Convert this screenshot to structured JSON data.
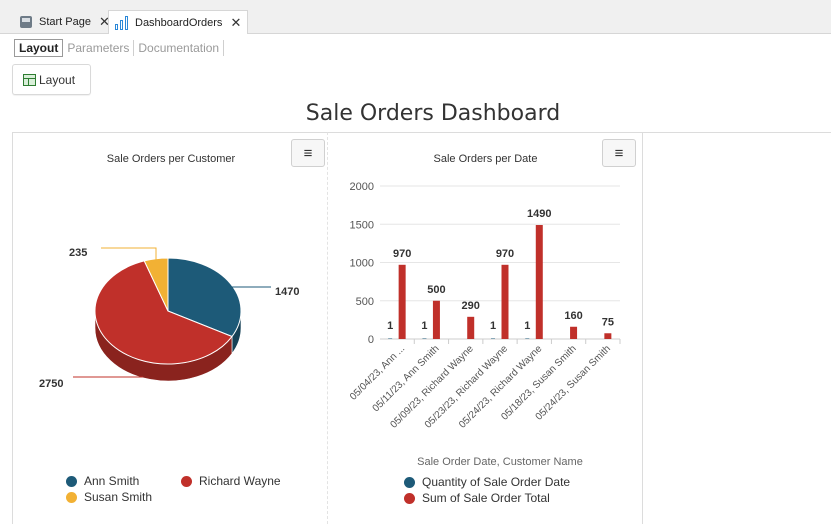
{
  "tabs": [
    {
      "label": "Start Page",
      "icon": "start-page-icon"
    },
    {
      "label": "DashboardOrders",
      "icon": "dashboard-icon"
    }
  ],
  "subtabs": [
    {
      "label": "Layout",
      "active": true
    },
    {
      "label": "Parameters",
      "active": false
    },
    {
      "label": "Documentation",
      "active": false
    }
  ],
  "toolbar": {
    "layout_button": "Layout"
  },
  "dashboard": {
    "title": "Sale Orders Dashboard"
  },
  "colors": {
    "blue": "#1d5a78",
    "red": "#c0302a",
    "yellow": "#f2b134"
  },
  "chart_data": [
    {
      "type": "pie",
      "title": "Sale Orders per Customer",
      "slices": [
        {
          "name": "Ann Smith",
          "value": 1470,
          "color": "#1d5a78"
        },
        {
          "name": "Richard Wayne",
          "value": 2750,
          "color": "#c0302a"
        },
        {
          "name": "Susan Smith",
          "value": 235,
          "color": "#f2b134"
        }
      ],
      "legend_placement": "bottom"
    },
    {
      "type": "bar",
      "title": "Sale Orders per Date",
      "xlabel": "Sale Order Date, Customer Name",
      "ylabel": "",
      "ylim": [
        0,
        2000
      ],
      "yticks": [
        "2000",
        "1500",
        "1000",
        "500",
        "0"
      ],
      "grid": true,
      "categories": [
        "05/04/23, Ann ...",
        "05/11/23, Ann Smith",
        "05/09/23, Richard Wayne",
        "05/23/23, Richard Wayne",
        "05/24/23, Richard Wayne",
        "05/18/23, Susan Smith",
        "05/24/23, Susan Smith"
      ],
      "series": [
        {
          "name": "Quantity of Sale Order Date",
          "color": "#1d5a78",
          "values": [
            1,
            1,
            null,
            1,
            1,
            null,
            null
          ]
        },
        {
          "name": "Sum of Sale Order Total",
          "color": "#c0302a",
          "values": [
            970,
            500,
            290,
            970,
            1490,
            160,
            75
          ]
        }
      ],
      "legend_placement": "bottom"
    }
  ]
}
